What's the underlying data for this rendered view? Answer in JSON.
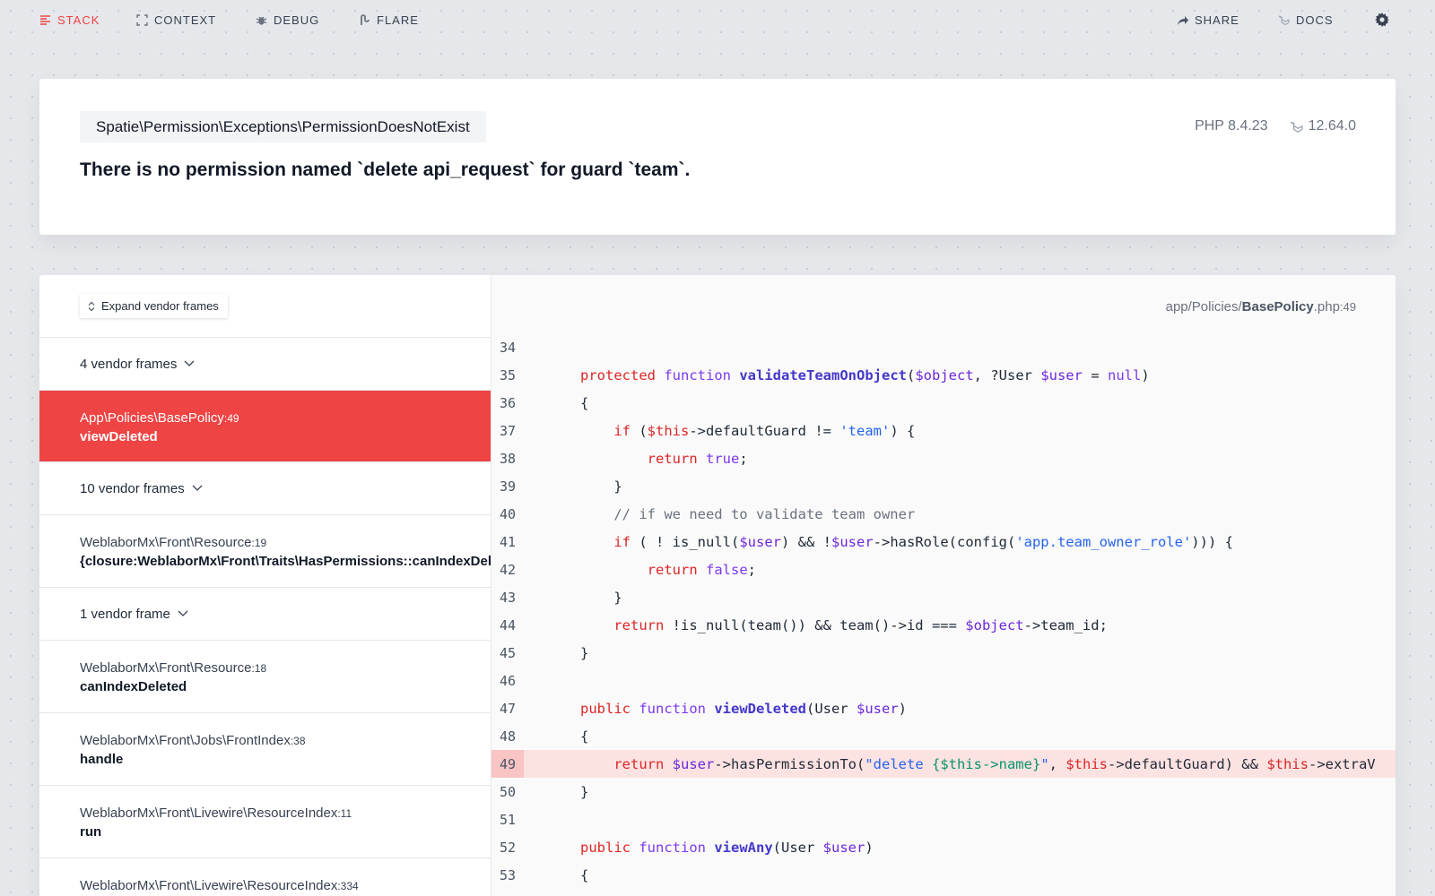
{
  "nav": {
    "stack": "STACK",
    "context": "CONTEXT",
    "debug": "DEBUG",
    "flare": "FLARE",
    "share": "SHARE",
    "docs": "DOCS"
  },
  "header": {
    "exception_class": "Spatie\\Permission\\Exceptions\\PermissionDoesNotExist",
    "message": "There is no permission named `delete api_request` for guard `team`.",
    "php_version": "PHP 8.4.23",
    "laravel_version": "12.64.0"
  },
  "frames_panel": {
    "expand_label": "Expand vendor frames",
    "group1": "4 vendor frames",
    "group2": "10 vendor frames",
    "group3": "1 vendor frame",
    "frames": [
      {
        "class": "App\\Policies\\BasePolicy",
        "line": ":49",
        "method": "viewDeleted"
      },
      {
        "class": "WeblaborMx\\Front\\Resource",
        "line": ":19",
        "method": "{closure:WeblaborMx\\Front\\Traits\\HasPermissions::canIndexDeleted"
      },
      {
        "class": "WeblaborMx\\Front\\Resource",
        "line": ":18",
        "method": "canIndexDeleted"
      },
      {
        "class": "WeblaborMx\\Front\\Jobs\\FrontIndex",
        "line": ":38",
        "method": "handle"
      },
      {
        "class": "WeblaborMx\\Front\\Livewire\\ResourceIndex",
        "line": ":11",
        "method": "run"
      },
      {
        "class": "WeblaborMx\\Front\\Livewire\\ResourceIndex",
        "line": ":334",
        "method": ""
      }
    ]
  },
  "code": {
    "file_dir": "app/Policies/",
    "file_name": "BasePolicy",
    "file_ext": ".php",
    "file_line": ":49",
    "line_numbers": [
      "34",
      "35",
      "36",
      "37",
      "38",
      "39",
      "40",
      "41",
      "42",
      "43",
      "44",
      "45",
      "46",
      "47",
      "48",
      "49",
      "50",
      "51",
      "52",
      "53"
    ],
    "highlighted_line": "49",
    "tokens": {
      "protected": "protected",
      "function": "function",
      "validate_fn": "validateTeamOnObject",
      "object_var": "$object",
      "user_type": ", ?User ",
      "user_var": "$user",
      "eq_null": " = ",
      "null": "null",
      "open_brace": "{",
      "close_brace": "}",
      "if": "if",
      "this": "$this",
      "default_guard_cmp": "->defaultGuard != ",
      "team_str": "'team'",
      "return": "return",
      "true": "true",
      "false": "false",
      "semi": ";",
      "comment": "// if we need to validate team owner",
      "not_is_null": " ! is_null(",
      "and_not": ") && !",
      "has_role": "->hasRole(config(",
      "owner_role_str": "'app.team_owner_role'",
      "close_41": "))) {",
      "return_44_body": " !is_null(team()) && team()->id === ",
      "team_id": "->team_id;",
      "public": "public",
      "view_deleted_fn": "viewDeleted",
      "user_param": "(User ",
      "has_perm": "->hasPermissionTo(",
      "perm_str_open": "\"delete ",
      "perm_interp": "{$this->name}",
      "perm_str_close": "\"",
      "comma": ", ",
      "default_guard_and": "->defaultGuard) && ",
      "extra": "->extraV",
      "view_any_fn": "viewAny"
    }
  }
}
